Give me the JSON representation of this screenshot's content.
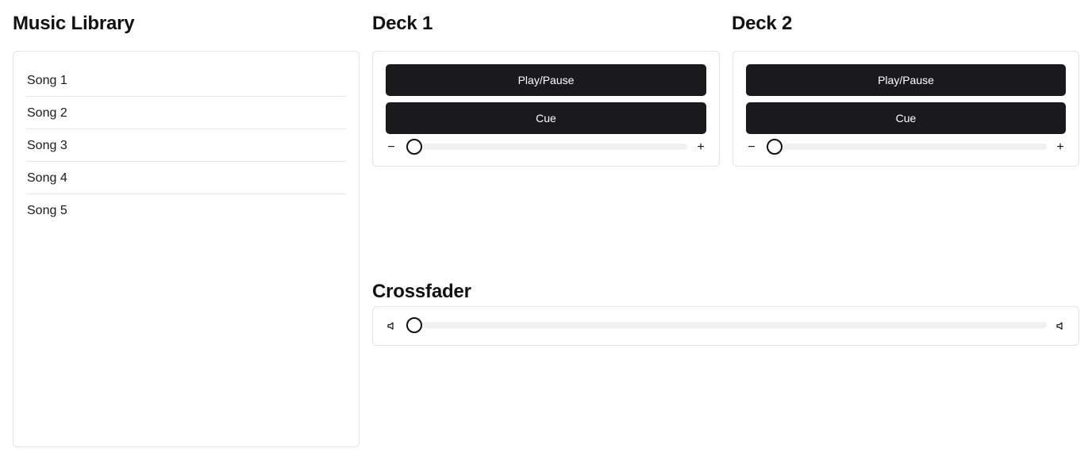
{
  "library": {
    "title": "Music Library",
    "songs": [
      "Song 1",
      "Song 2",
      "Song 3",
      "Song 4",
      "Song 5"
    ]
  },
  "deck1": {
    "title": "Deck 1",
    "play_label": "Play/Pause",
    "cue_label": "Cue",
    "minus_symbol": "−",
    "plus_symbol": "+",
    "slider_value": 0
  },
  "deck2": {
    "title": "Deck 2",
    "play_label": "Play/Pause",
    "cue_label": "Cue",
    "minus_symbol": "−",
    "plus_symbol": "+",
    "slider_value": 0
  },
  "crossfader": {
    "title": "Crossfader",
    "left_icon": "speaker-icon",
    "right_icon": "speaker-icon",
    "value": 0
  },
  "colors": {
    "button_bg": "#1a1a1c",
    "button_text": "#ffffff",
    "border": "#e4e4e4",
    "track": "#f1f1f1"
  }
}
